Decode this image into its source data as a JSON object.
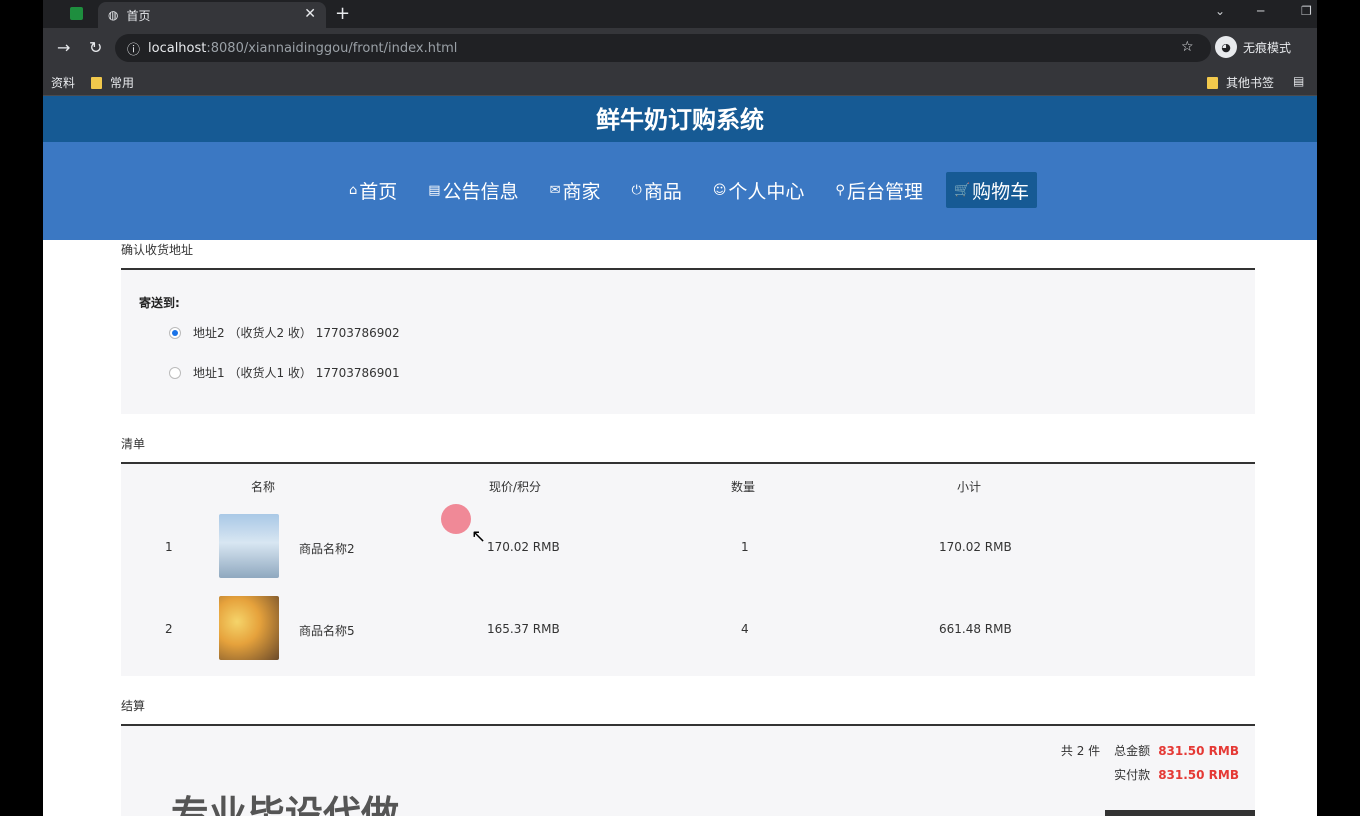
{
  "browser": {
    "tab_title": "首页",
    "url_host": "localhost",
    "url_rest": ":8080/xiannaidinggou/front/index.html",
    "profile_label": "无痕模式",
    "bookmarks": [
      "资料",
      "常用"
    ],
    "bookmarks_right": "其他书签"
  },
  "site": {
    "title": "鲜牛奶订购系统",
    "nav": [
      {
        "icon": "⌂",
        "label": "首页"
      },
      {
        "icon": "▤",
        "label": "公告信息"
      },
      {
        "icon": "✉",
        "label": "商家"
      },
      {
        "icon": "⏻",
        "label": "商品"
      },
      {
        "icon": "☺",
        "label": "个人中心"
      },
      {
        "icon": "⚲",
        "label": "后台管理"
      },
      {
        "icon": "🛒",
        "label": "购物车"
      }
    ]
  },
  "address": {
    "section_title": "确认收货地址",
    "ship_to_label": "寄送到:",
    "options": [
      {
        "text": "地址2 （收货人2 收） 17703786902",
        "checked": true
      },
      {
        "text": "地址1 （收货人1 收） 17703786901",
        "checked": false
      }
    ]
  },
  "items": {
    "section_title": "清单",
    "headers": [
      "名称",
      "现价/积分",
      "数量",
      "小计"
    ],
    "rows": [
      {
        "index": "1",
        "name": "商品名称2",
        "price": "170.02 RMB",
        "qty": "1",
        "subtotal": "170.02 RMB"
      },
      {
        "index": "2",
        "name": "商品名称5",
        "price": "165.37 RMB",
        "qty": "4",
        "subtotal": "661.48 RMB"
      }
    ]
  },
  "summary": {
    "section_title": "结算",
    "count_label": "共 2 件",
    "total_label": "总金额",
    "total_value": "831.50 RMB",
    "paid_label": "实付款",
    "paid_value": "831.50 RMB"
  },
  "promo_text": "专业毕设代做"
}
